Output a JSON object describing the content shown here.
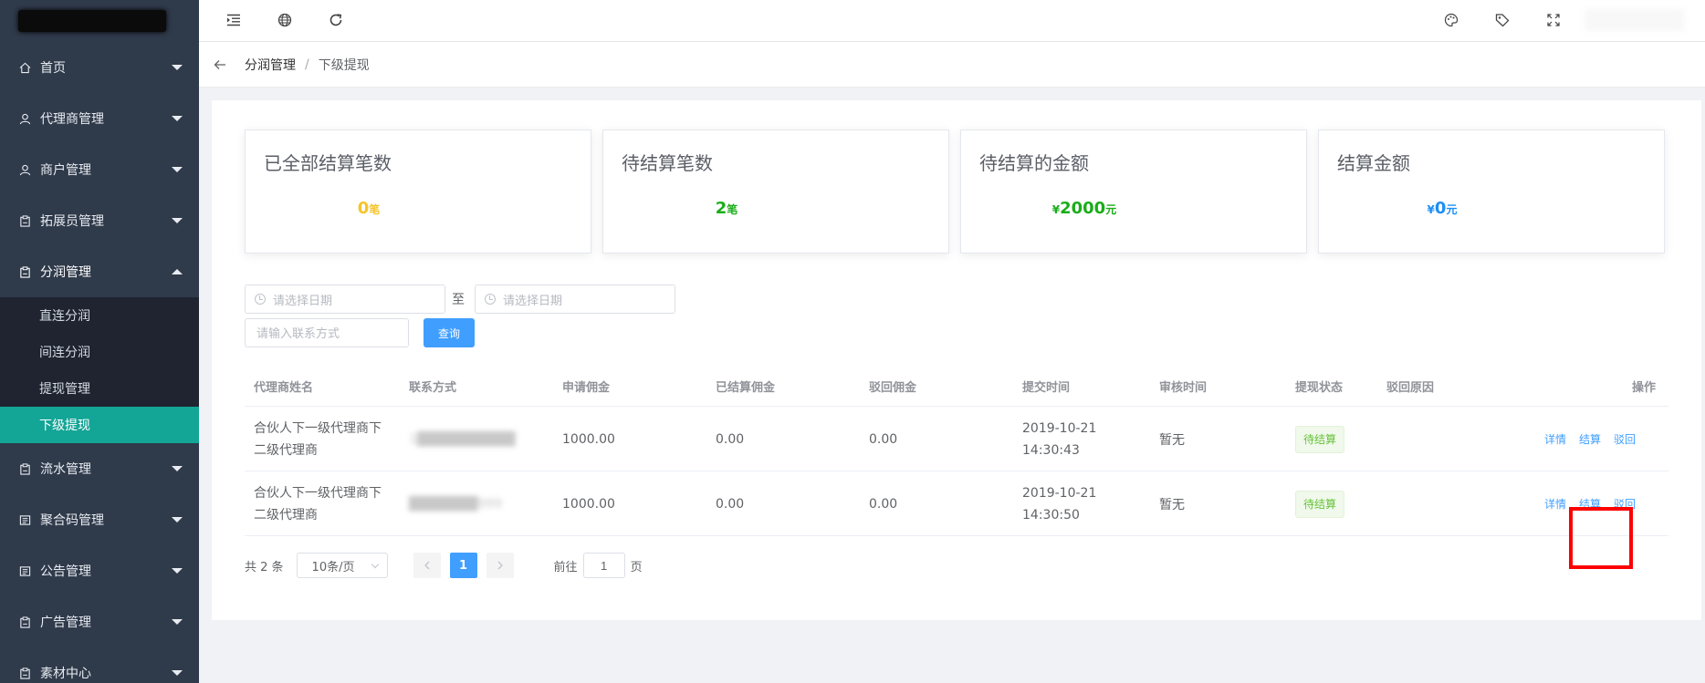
{
  "sidebar": {
    "menu": [
      {
        "label": "首页",
        "icon": "home-icon"
      },
      {
        "label": "代理商管理",
        "icon": "user-icon"
      },
      {
        "label": "商户管理",
        "icon": "user-icon"
      },
      {
        "label": "拓展员管理",
        "icon": "clipboard-icon"
      },
      {
        "label": "分润管理",
        "icon": "clipboard-icon"
      }
    ],
    "submenu": [
      "直连分润",
      "间连分润",
      "提现管理",
      "下级提现"
    ],
    "menu_after": [
      {
        "label": "流水管理",
        "icon": "clipboard-icon"
      },
      {
        "label": "聚合码管理",
        "icon": "document-icon"
      },
      {
        "label": "公告管理",
        "icon": "document-icon"
      },
      {
        "label": "广告管理",
        "icon": "clipboard-icon"
      },
      {
        "label": "素材中心",
        "icon": "clipboard-icon"
      }
    ]
  },
  "topbar": {
    "icons": [
      "indent-icon",
      "globe-icon",
      "refresh-icon",
      "palette-icon",
      "tag-icon",
      "fullscreen-icon"
    ]
  },
  "breadcrumb": {
    "parent": "分润管理",
    "separator": "/",
    "current": "下级提现"
  },
  "stats": [
    {
      "title": "已全部结算笔数",
      "prefix": "",
      "value": "0",
      "unit": "笔",
      "color": "#f6c42a"
    },
    {
      "title": "待结算笔数",
      "prefix": "",
      "value": "2",
      "unit": "笔",
      "color": "#1aad19"
    },
    {
      "title": "待结算的金额",
      "prefix": "¥",
      "value": "2000",
      "unit": "元",
      "color": "#1aad19"
    },
    {
      "title": "结算金额",
      "prefix": "¥",
      "value": "0",
      "unit": "元",
      "color": "#1c8ff5"
    }
  ],
  "filter": {
    "start_placeholder": "请选择日期",
    "to_label": "至",
    "end_placeholder": "请选择日期",
    "contact_placeholder": "请输入联系方式",
    "query_label": "查询"
  },
  "table": {
    "headers": [
      "代理商姓名",
      "联系方式",
      "申请佣金",
      "已结算佣金",
      "驳回佣金",
      "提交时间",
      "审核时间",
      "提现状态",
      "驳回原因",
      "操作"
    ],
    "rows": [
      {
        "name": "合伙人下一级代理商下二级代理商",
        "contact": "1██████████",
        "apply": "1000.00",
        "settled": "0.00",
        "rejected": "0.00",
        "submit_time": "2019-10-21 14:30:43",
        "review_time": "暂无",
        "status": "待结算",
        "reason": "",
        "actions": [
          "详情",
          "结算",
          "驳回"
        ]
      },
      {
        "name": "合伙人下一级代理商下二级代理商",
        "contact": "███████999",
        "apply": "1000.00",
        "settled": "0.00",
        "rejected": "0.00",
        "submit_time": "2019-10-21 14:30:50",
        "review_time": "暂无",
        "status": "待结算",
        "reason": "",
        "actions": [
          "详情",
          "结算",
          "驳回"
        ]
      }
    ]
  },
  "pagination": {
    "total": "共 2 条",
    "page_size": "10条/页",
    "current_page": "1",
    "goto_prefix": "前往",
    "goto_value": "1",
    "goto_suffix": "页"
  },
  "colors": {
    "sidebar_bg": "#2f3a4a",
    "active_submenu": "#13a596",
    "primary": "#409eff",
    "highlight_box": "#ff0000"
  }
}
